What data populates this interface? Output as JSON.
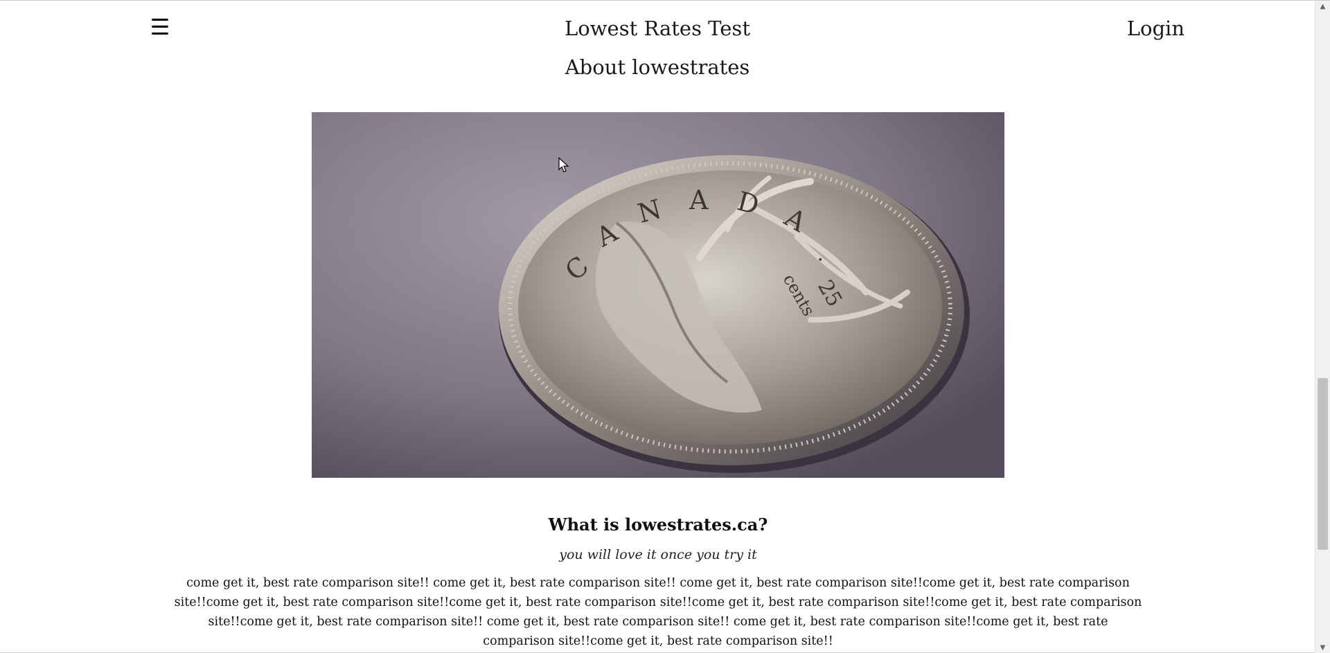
{
  "header": {
    "menu_icon": "☰",
    "title": "Lowest Rates Test",
    "login_label": "Login"
  },
  "page": {
    "heading": "About lowestrates"
  },
  "hero_image": {
    "coin_text": "CANADA",
    "coin_value": "25",
    "coin_unit": "cents"
  },
  "content": {
    "heading": "What is lowestrates.ca?",
    "tagline": "you will love it once you try it",
    "body": "come get it, best rate comparison site!! come get it, best rate comparison site!! come get it, best rate comparison site!!come get it, best rate comparison site!!come get it, best rate comparison site!!come get it, best rate comparison site!!come get it, best rate comparison site!!come get it, best rate comparison site!!come get it, best rate comparison site!! come get it, best rate comparison site!! come get it, best rate comparison site!!come get it, best rate comparison site!!come get it, best rate comparison site!!"
  },
  "scrollbar": {
    "up_arrow": "▲",
    "down_arrow": "▼"
  },
  "colors": {
    "text": "#111111",
    "background": "#ffffff",
    "hero_bg": "#7c7383",
    "coin": "#b9b3ac"
  }
}
